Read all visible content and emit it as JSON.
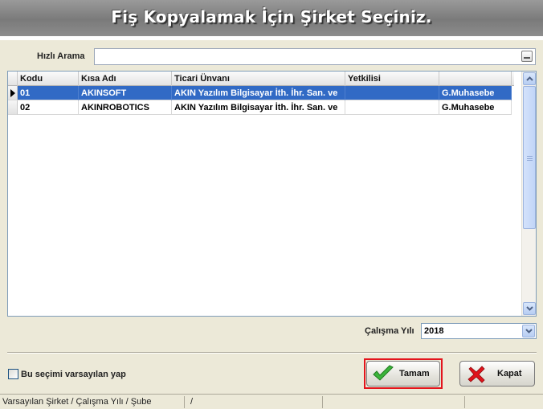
{
  "title": "Fiş Kopyalamak İçin Şirket Seçiniz.",
  "search": {
    "label": "Hızlı Arama",
    "value": "",
    "placeholder": ""
  },
  "grid": {
    "columns": [
      "Kodu",
      "Kısa Adı",
      "Ticari Ünvanı",
      "Yetkilisi",
      ""
    ],
    "rows": [
      {
        "kodu": "01",
        "kisa_adi": "AKINSOFT",
        "ticari_unvani": "AKIN Yazılım Bilgisayar İth. İhr. San. ve",
        "yetkilisi": "",
        "extra": "G.Muhasebe",
        "selected": true
      },
      {
        "kodu": "02",
        "kisa_adi": "AKINROBOTICS",
        "ticari_unvani": "AKIN Yazılım Bilgisayar İth. İhr. San. ve",
        "yetkilisi": "",
        "extra": "G.Muhasebe",
        "selected": false
      }
    ]
  },
  "year": {
    "label": "Çalışma Yılı",
    "value": "2018"
  },
  "default_checkbox": {
    "label": "Bu seçimi varsayılan yap",
    "checked": false
  },
  "buttons": {
    "ok": "Tamam",
    "close": "Kapat"
  },
  "status": {
    "panes": [
      "Varsayılan Şirket / Çalışma Yılı / Şube",
      "/",
      "",
      ""
    ]
  },
  "colors": {
    "selection": "#316ac5",
    "highlight_frame": "#e3141c",
    "ok_icon": "#3bb43b",
    "close_icon": "#e0141b"
  },
  "icons": {
    "ok": "check-icon",
    "close": "x-icon"
  }
}
